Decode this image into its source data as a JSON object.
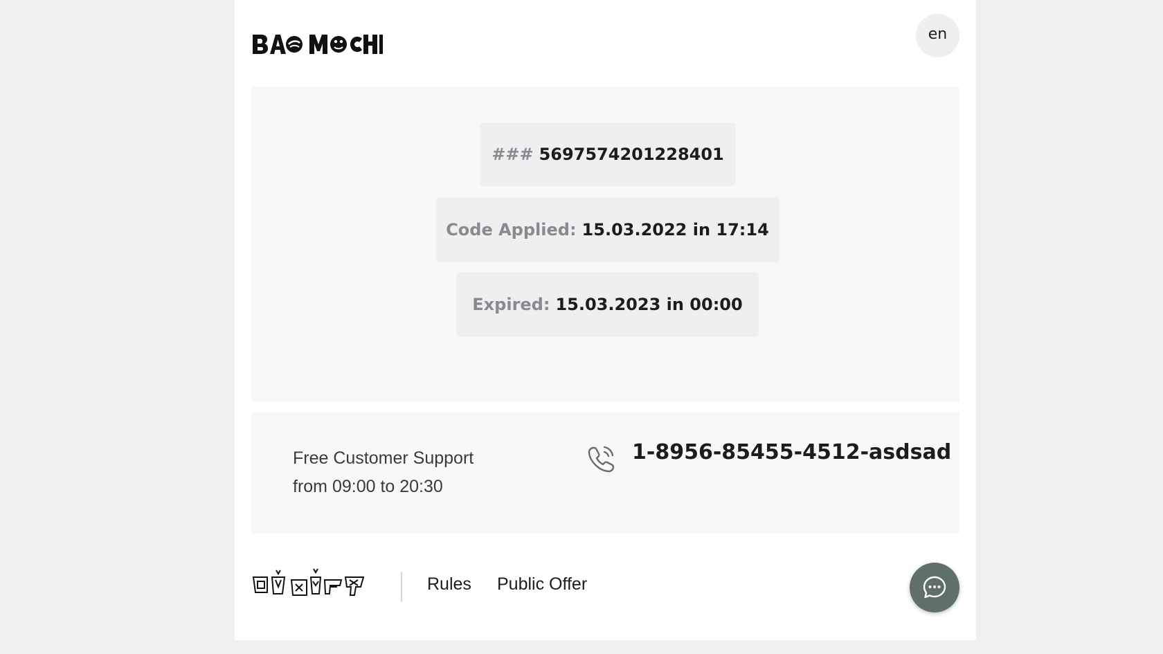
{
  "header": {
    "logo_text": "BAO MOCHI",
    "lang_label": "en"
  },
  "code_card": {
    "code_prefix": "###",
    "code_value": "5697574201228401",
    "applied_label": "Code Applied:",
    "applied_value": "15.03.2022 in 17:14",
    "expired_label": "Expired:",
    "expired_value": "15.03.2023 in 00:00"
  },
  "support": {
    "line1": "Free Customer Support",
    "line2": "from 09:00 to 20:30",
    "phone_icon": "phone-icon",
    "phone_number": "1-8956-85455-4512-asdsad"
  },
  "footer": {
    "partner_logo": "footer-brand-logo",
    "links": [
      "Rules",
      "Public Offer"
    ]
  },
  "chat": {
    "icon": "chat-bubble-icon",
    "color": "#5f6f6a"
  }
}
